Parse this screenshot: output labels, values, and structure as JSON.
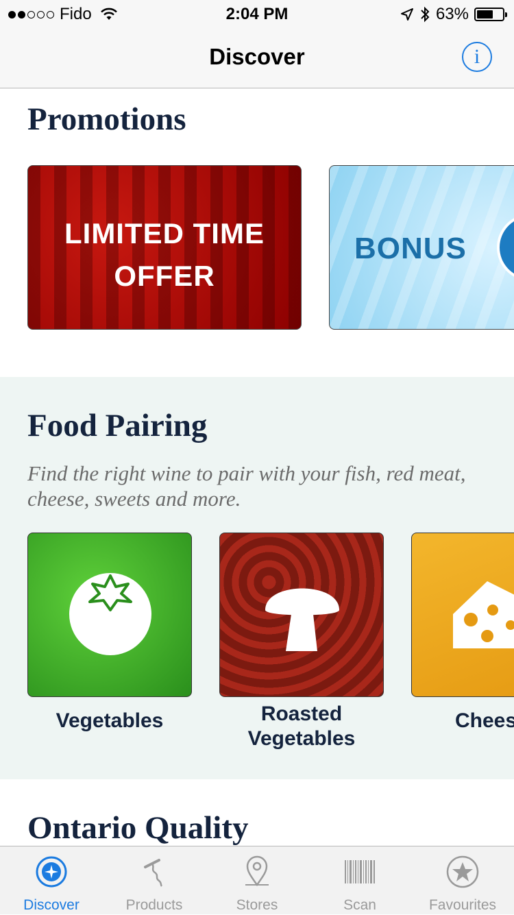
{
  "status_bar": {
    "carrier": "Fido",
    "time": "2:04 PM",
    "battery_percent": "63%",
    "battery_level": 0.63
  },
  "nav": {
    "title": "Discover",
    "info_label": "i"
  },
  "promotions": {
    "heading": "Promotions",
    "cards": [
      {
        "line1": "LIMITED TIME",
        "line2": "OFFER"
      },
      {
        "text": "BONUS"
      }
    ]
  },
  "food_pairing": {
    "heading": "Food Pairing",
    "subtitle": "Find the right wine to pair with your fish, red meat, cheese, sweets and more.",
    "items": [
      {
        "label": "Vegetables",
        "icon": "tomato-icon"
      },
      {
        "label": "Roasted Vegetables",
        "icon": "mushroom-icon"
      },
      {
        "label": "Chees",
        "icon": "cheese-icon"
      }
    ]
  },
  "ontario": {
    "heading": "Ontario Quality"
  },
  "tabs": [
    {
      "label": "Discover",
      "icon": "compass-icon",
      "active": true
    },
    {
      "label": "Products",
      "icon": "corkscrew-icon",
      "active": false
    },
    {
      "label": "Stores",
      "icon": "map-pin-icon",
      "active": false
    },
    {
      "label": "Scan",
      "icon": "barcode-icon",
      "active": false
    },
    {
      "label": "Favourites",
      "icon": "star-icon",
      "active": false
    }
  ],
  "colors": {
    "accent": "#1b7be0",
    "heading": "#14233d",
    "food_bg": "#eef5f3"
  }
}
